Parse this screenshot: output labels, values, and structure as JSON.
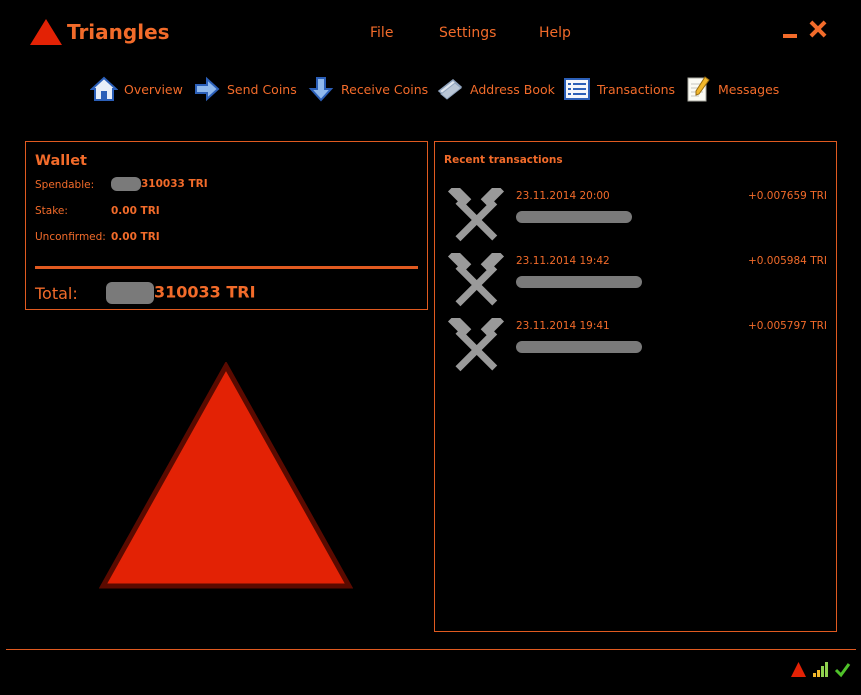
{
  "app": {
    "title": "Triangles"
  },
  "menu": {
    "file": "File",
    "settings": "Settings",
    "help": "Help"
  },
  "nav": [
    {
      "label": "Overview",
      "icon": "home-icon"
    },
    {
      "label": "Send Coins",
      "icon": "send-arrow-icon"
    },
    {
      "label": "Receive Coins",
      "icon": "receive-arrow-icon"
    },
    {
      "label": "Address Book",
      "icon": "address-book-icon"
    },
    {
      "label": "Transactions",
      "icon": "transactions-list-icon"
    },
    {
      "label": "Messages",
      "icon": "messages-notepad-icon"
    }
  ],
  "wallet": {
    "title": "Wallet",
    "spendable_label": "Spendable:",
    "spendable_value": "310033 TRI",
    "stake_label": "Stake:",
    "stake_value": "0.00 TRI",
    "unconfirmed_label": "Unconfirmed:",
    "unconfirmed_value": "0.00 TRI",
    "total_label": "Total:",
    "total_value": "310033 TRI"
  },
  "recent": {
    "title": "Recent transactions",
    "items": [
      {
        "date": "23.11.2014 20:00",
        "amount": "+0.007659 TRI",
        "icon": "mining-hammers-icon"
      },
      {
        "date": "23.11.2014 19:42",
        "amount": "+0.005984 TRI",
        "icon": "mining-hammers-icon"
      },
      {
        "date": "23.11.2014 19:41",
        "amount": "+0.005797 TRI",
        "icon": "mining-hammers-icon"
      }
    ]
  },
  "status": {
    "icons": [
      "triangle-logo-icon",
      "signal-bars-icon",
      "synced-check-icon"
    ]
  },
  "colors": {
    "accent": "#f26b2a",
    "border": "#e05a20",
    "triangle": "#e32205",
    "triangle_outline": "#5a0a00",
    "background": "#000000"
  }
}
